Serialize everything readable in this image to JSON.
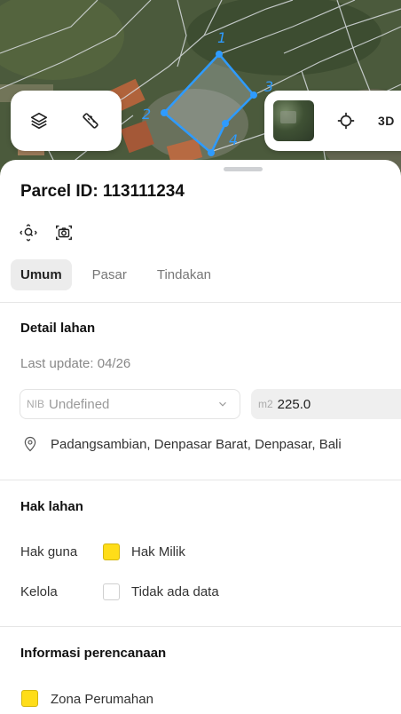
{
  "map": {
    "vertex_labels": [
      "1",
      "2",
      "3",
      "4"
    ],
    "colors": {
      "parcel_outline": "#2e9bff",
      "boundary_lines": "#d9dde0",
      "roof": "#b0633b"
    },
    "controls": {
      "layers_icon": "layers-icon",
      "ruler_icon": "ruler-icon",
      "basemap_thumbnail": "satellite-thumbnail",
      "locate_icon": "crosshair-icon",
      "toggle_3d_label": "3D"
    }
  },
  "parcel": {
    "title": "Parcel ID: 113111234",
    "tools": {
      "zoom_icon": "zoom-to-fit-icon",
      "screenshot_icon": "camera-icon"
    }
  },
  "tabs": [
    {
      "label": "Umum",
      "active": true
    },
    {
      "label": "Pasar",
      "active": false
    },
    {
      "label": "Tindakan",
      "active": false
    }
  ],
  "detail": {
    "title": "Detail lahan",
    "last_update": "Last update: 04/26",
    "nib_prefix": "NIB",
    "nib_value": "Undefined",
    "area_prefix": "m2",
    "area_value": "225.0",
    "location": "Padangsambian, Denpasar Barat, Denpasar, Bali"
  },
  "rights": {
    "title": "Hak lahan",
    "rows": [
      {
        "label": "Hak guna",
        "value": "Hak Milik",
        "swatch_color": "#ffdd19"
      },
      {
        "label": "Kelola",
        "value": "Tidak ada data",
        "swatch_color": "#ffffff"
      }
    ]
  },
  "planning": {
    "title": "Informasi perencanaan",
    "zone": "Zona Perumahan",
    "zone_color": "#ffdd19"
  }
}
